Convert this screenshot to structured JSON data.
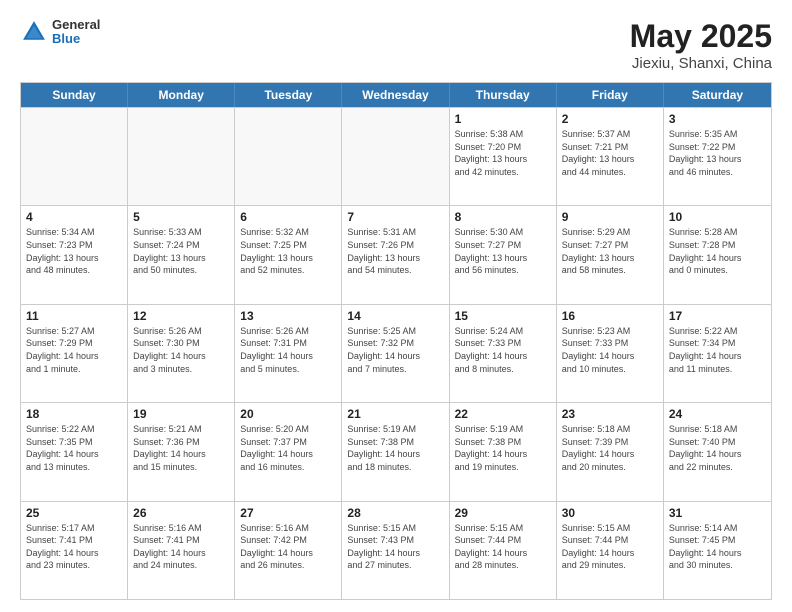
{
  "header": {
    "logo": {
      "line1": "General",
      "line2": "Blue"
    },
    "title": "May 2025",
    "location": "Jiexiu, Shanxi, China"
  },
  "weekdays": [
    "Sunday",
    "Monday",
    "Tuesday",
    "Wednesday",
    "Thursday",
    "Friday",
    "Saturday"
  ],
  "rows": [
    [
      {
        "day": "",
        "info": "",
        "empty": true
      },
      {
        "day": "",
        "info": "",
        "empty": true
      },
      {
        "day": "",
        "info": "",
        "empty": true
      },
      {
        "day": "",
        "info": "",
        "empty": true
      },
      {
        "day": "1",
        "info": "Sunrise: 5:38 AM\nSunset: 7:20 PM\nDaylight: 13 hours\nand 42 minutes."
      },
      {
        "day": "2",
        "info": "Sunrise: 5:37 AM\nSunset: 7:21 PM\nDaylight: 13 hours\nand 44 minutes."
      },
      {
        "day": "3",
        "info": "Sunrise: 5:35 AM\nSunset: 7:22 PM\nDaylight: 13 hours\nand 46 minutes."
      }
    ],
    [
      {
        "day": "4",
        "info": "Sunrise: 5:34 AM\nSunset: 7:23 PM\nDaylight: 13 hours\nand 48 minutes."
      },
      {
        "day": "5",
        "info": "Sunrise: 5:33 AM\nSunset: 7:24 PM\nDaylight: 13 hours\nand 50 minutes."
      },
      {
        "day": "6",
        "info": "Sunrise: 5:32 AM\nSunset: 7:25 PM\nDaylight: 13 hours\nand 52 minutes."
      },
      {
        "day": "7",
        "info": "Sunrise: 5:31 AM\nSunset: 7:26 PM\nDaylight: 13 hours\nand 54 minutes."
      },
      {
        "day": "8",
        "info": "Sunrise: 5:30 AM\nSunset: 7:27 PM\nDaylight: 13 hours\nand 56 minutes."
      },
      {
        "day": "9",
        "info": "Sunrise: 5:29 AM\nSunset: 7:27 PM\nDaylight: 13 hours\nand 58 minutes."
      },
      {
        "day": "10",
        "info": "Sunrise: 5:28 AM\nSunset: 7:28 PM\nDaylight: 14 hours\nand 0 minutes."
      }
    ],
    [
      {
        "day": "11",
        "info": "Sunrise: 5:27 AM\nSunset: 7:29 PM\nDaylight: 14 hours\nand 1 minute."
      },
      {
        "day": "12",
        "info": "Sunrise: 5:26 AM\nSunset: 7:30 PM\nDaylight: 14 hours\nand 3 minutes."
      },
      {
        "day": "13",
        "info": "Sunrise: 5:26 AM\nSunset: 7:31 PM\nDaylight: 14 hours\nand 5 minutes."
      },
      {
        "day": "14",
        "info": "Sunrise: 5:25 AM\nSunset: 7:32 PM\nDaylight: 14 hours\nand 7 minutes."
      },
      {
        "day": "15",
        "info": "Sunrise: 5:24 AM\nSunset: 7:33 PM\nDaylight: 14 hours\nand 8 minutes."
      },
      {
        "day": "16",
        "info": "Sunrise: 5:23 AM\nSunset: 7:33 PM\nDaylight: 14 hours\nand 10 minutes."
      },
      {
        "day": "17",
        "info": "Sunrise: 5:22 AM\nSunset: 7:34 PM\nDaylight: 14 hours\nand 11 minutes."
      }
    ],
    [
      {
        "day": "18",
        "info": "Sunrise: 5:22 AM\nSunset: 7:35 PM\nDaylight: 14 hours\nand 13 minutes."
      },
      {
        "day": "19",
        "info": "Sunrise: 5:21 AM\nSunset: 7:36 PM\nDaylight: 14 hours\nand 15 minutes."
      },
      {
        "day": "20",
        "info": "Sunrise: 5:20 AM\nSunset: 7:37 PM\nDaylight: 14 hours\nand 16 minutes."
      },
      {
        "day": "21",
        "info": "Sunrise: 5:19 AM\nSunset: 7:38 PM\nDaylight: 14 hours\nand 18 minutes."
      },
      {
        "day": "22",
        "info": "Sunrise: 5:19 AM\nSunset: 7:38 PM\nDaylight: 14 hours\nand 19 minutes."
      },
      {
        "day": "23",
        "info": "Sunrise: 5:18 AM\nSunset: 7:39 PM\nDaylight: 14 hours\nand 20 minutes."
      },
      {
        "day": "24",
        "info": "Sunrise: 5:18 AM\nSunset: 7:40 PM\nDaylight: 14 hours\nand 22 minutes."
      }
    ],
    [
      {
        "day": "25",
        "info": "Sunrise: 5:17 AM\nSunset: 7:41 PM\nDaylight: 14 hours\nand 23 minutes."
      },
      {
        "day": "26",
        "info": "Sunrise: 5:16 AM\nSunset: 7:41 PM\nDaylight: 14 hours\nand 24 minutes."
      },
      {
        "day": "27",
        "info": "Sunrise: 5:16 AM\nSunset: 7:42 PM\nDaylight: 14 hours\nand 26 minutes."
      },
      {
        "day": "28",
        "info": "Sunrise: 5:15 AM\nSunset: 7:43 PM\nDaylight: 14 hours\nand 27 minutes."
      },
      {
        "day": "29",
        "info": "Sunrise: 5:15 AM\nSunset: 7:44 PM\nDaylight: 14 hours\nand 28 minutes."
      },
      {
        "day": "30",
        "info": "Sunrise: 5:15 AM\nSunset: 7:44 PM\nDaylight: 14 hours\nand 29 minutes."
      },
      {
        "day": "31",
        "info": "Sunrise: 5:14 AM\nSunset: 7:45 PM\nDaylight: 14 hours\nand 30 minutes."
      }
    ]
  ]
}
